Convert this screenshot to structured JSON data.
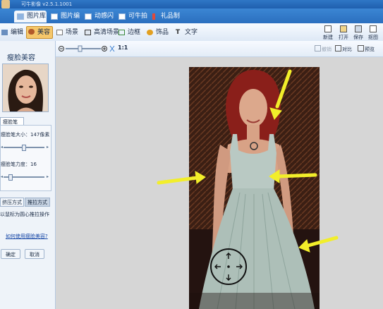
{
  "window": {
    "title": "可牛影像 v2.5.1.1001"
  },
  "main_tabs": [
    {
      "label": "图片库"
    },
    {
      "label": "图片编辑"
    },
    {
      "label": "动感闪图"
    },
    {
      "label": "可牛拍照"
    },
    {
      "label": "礼品制作"
    }
  ],
  "toolbar": {
    "tools": [
      {
        "label": "编辑"
      },
      {
        "label": "美容"
      },
      {
        "label": "场景"
      },
      {
        "label": "高清场景"
      },
      {
        "label": "边框"
      },
      {
        "label": "饰品"
      },
      {
        "label": "文字"
      }
    ],
    "right_buttons": [
      {
        "label": "新建"
      },
      {
        "label": "打开"
      },
      {
        "label": "保存"
      },
      {
        "label": "抠图"
      }
    ]
  },
  "left_panel": {
    "title": "瘦脸美容",
    "subtab": "瘦脸笔",
    "brush_size_label": "瘦脸笔大小：147像素",
    "brush_strength_label": "瘦脸笔力度：16",
    "brush_size_slider_level": 0.5,
    "brush_strength_slider_level": 0.18,
    "mode_buttons": [
      "挤压方式",
      "推拉方式"
    ],
    "active_mode": "推拉方式",
    "tip": "以鼠标为圆心推拉操作",
    "help_link": "如何使用瘦脸美容?",
    "confirm_button": "确定",
    "cancel_button": "取消"
  },
  "canvas_toolbar": {
    "zoom_ratio": "1:1",
    "restore_label": "撤销",
    "compare_label": "对比",
    "preview_label": "预览"
  },
  "colors": {
    "title_blue": "#1f5fae",
    "tab_blue": "#2b6fbf",
    "active_tool": "#f5c76a",
    "annotation_arrow": "#f2ee2a",
    "canvas_gray": "#d6d6d6"
  }
}
